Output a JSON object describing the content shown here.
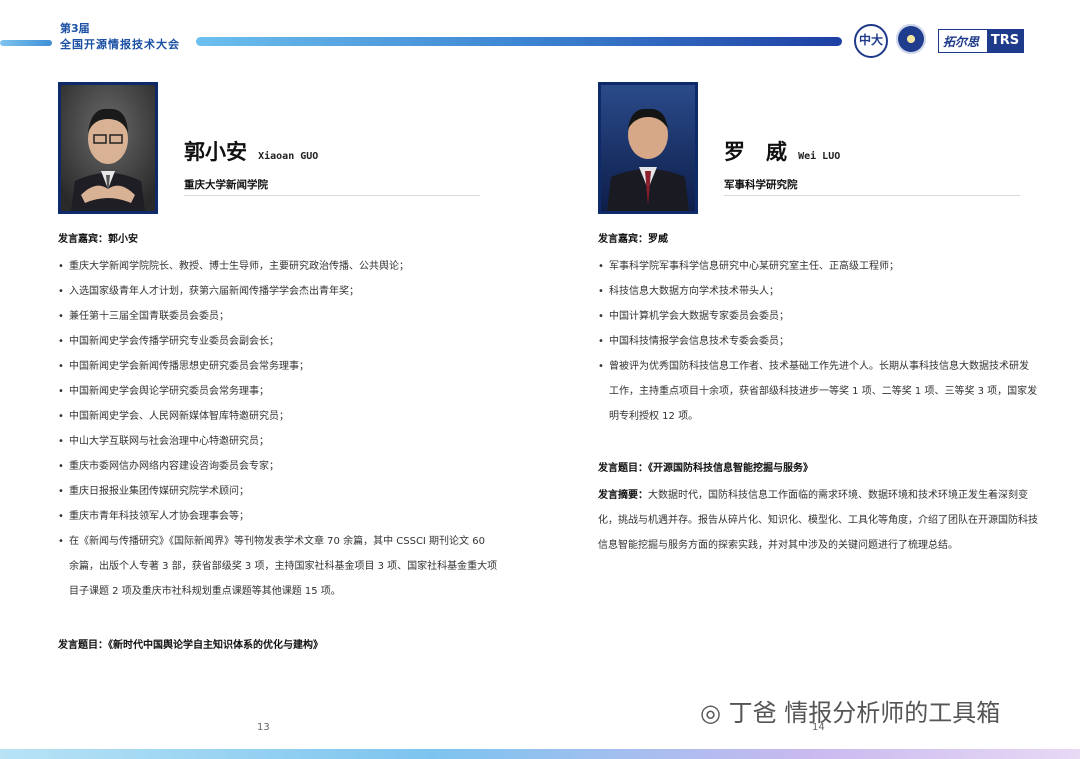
{
  "header": {
    "edition": "第3届",
    "conference": "全国开源情报技术大会",
    "logo1_text": "中大",
    "logo3_text_cn": "拓尔思",
    "logo3_text_en": "TRS"
  },
  "left": {
    "name_cn": "郭小安",
    "name_en": "Xiaoan GUO",
    "affiliation": "重庆大学新闻学院",
    "speaker_label": "发言嘉宾：郭小安",
    "bullets": [
      "重庆大学新闻学院院长、教授、博士生导师，主要研究政治传播、公共舆论；",
      "入选国家级青年人才计划，获第六届新闻传播学学会杰出青年奖；",
      "兼任第十三届全国青联委员会委员；",
      "中国新闻史学会传播学研究专业委员会副会长；",
      "中国新闻史学会新闻传播思想史研究委员会常务理事；",
      "中国新闻史学会舆论学研究委员会常务理事；",
      "中国新闻史学会、人民网新媒体智库特邀研究员；",
      "中山大学互联网与社会治理中心特邀研究员；",
      "重庆市委网信办网络内容建设咨询委员会专家；",
      "重庆日报报业集团传媒研究院学术顾问；",
      "重庆市青年科技领军人才协会理事会等；",
      "在《新闻与传播研究》《国际新闻界》等刊物发表学术文章 70 余篇，其中 CSSCI 期刊论文 60 余篇，出版个人专著 3 部，获省部级奖 3 项，主持国家社科基金项目 3 项、国家社科基金重大项目子课题 2 项及重庆市社科规划重点课题等其他课题 15 项。"
    ],
    "topic": "发言题目：《新时代中国舆论学自主知识体系的优化与建构》",
    "page": "13"
  },
  "right": {
    "name_cn": "罗　威",
    "name_en": "Wei LUO",
    "affiliation": "军事科学研究院",
    "speaker_label": "发言嘉宾：罗威",
    "bullets": [
      "军事科学院军事科学信息研究中心某研究室主任、正高级工程师；",
      "科技信息大数据方向学术技术带头人；",
      "中国计算机学会大数据专家委员会委员；",
      "中国科技情报学会信息技术专委会委员；",
      "曾被评为优秀国防科技信息工作者、技术基础工作先进个人。长期从事科技信息大数据技术研发工作，主持重点项目十余项，获省部级科技进步一等奖 1 项、二等奖 1 项、三等奖 3 项，国家发明专利授权 12 项。"
    ],
    "topic": "发言题目：《开源国防科技信息智能挖掘与服务》",
    "abstract_label": "发言摘要：",
    "abstract": "大数据时代，国防科技信息工作面临的需求环境、数据环境和技术环境正发生着深刻变化，挑战与机遇并存。报告从碎片化、知识化、模型化、工具化等角度，介绍了团队在开源国防科技信息智能挖掘与服务方面的探索实践，并对其中涉及的关键问题进行了梳理总结。",
    "page": "14"
  },
  "watermark": "丁爸 情报分析师的工具箱",
  "colors": {
    "primary": "#1a4fa3",
    "photo_border": "#0f2a6b"
  }
}
